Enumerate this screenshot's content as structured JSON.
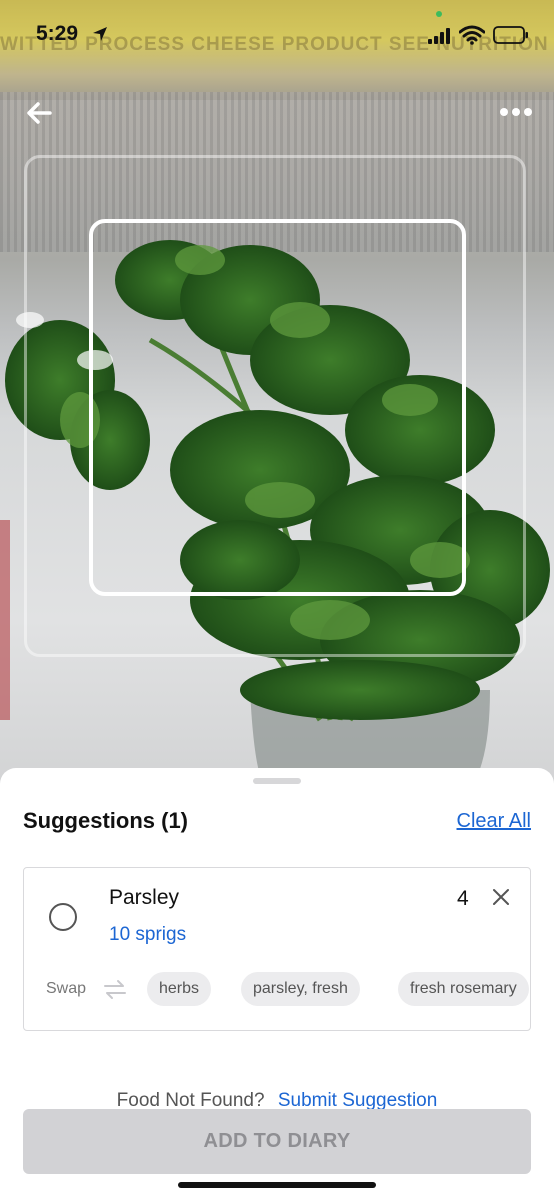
{
  "status_bar": {
    "time": "5:29",
    "icons": [
      "location-arrow-icon",
      "signal-icon",
      "wifi-icon",
      "battery-icon"
    ]
  },
  "camera": {
    "background_text": "WITTED PROCESS CHEESE PRODUCT    SEE NUTRITION INFORMATION FOR SODIUM CONTENT",
    "top_controls": {
      "back_icon": "arrow-left-icon",
      "more_icon": "more-horizontal-icon"
    }
  },
  "sheet": {
    "title": "Suggestions (1)",
    "clear_all": "Clear All",
    "suggestion": {
      "name": "Parsley",
      "serving": "10 sprigs",
      "quantity": "4",
      "selected": false,
      "swap_label": "Swap",
      "swap_options": [
        "herbs",
        "parsley, fresh",
        "fresh rosemary"
      ]
    },
    "not_found_label": "Food Not Found?",
    "submit_suggestion": "Submit Suggestion",
    "add_button": "ADD TO DIARY"
  },
  "colors": {
    "link": "#1c66d3",
    "disabled_button_bg": "#d2d2d5",
    "disabled_button_text": "#8f8f93",
    "chip_bg": "#ececee"
  }
}
